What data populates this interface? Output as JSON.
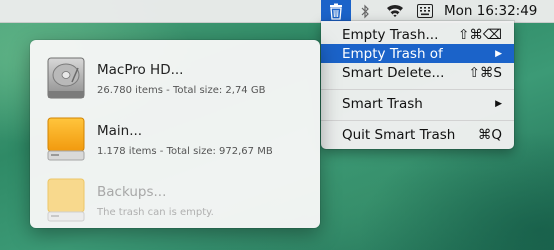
{
  "menubar": {
    "clock": "Mon 16:32:49",
    "icons": [
      "trash-icon",
      "bluetooth-icon",
      "wifi-icon",
      "keyboard-icon"
    ]
  },
  "menu": {
    "items": [
      {
        "label": "Empty Trash...",
        "shortcut": "⇧⌘⌫"
      },
      {
        "label": "Empty Trash of",
        "submenu": true,
        "selected": true
      },
      {
        "label": "Smart Delete...",
        "shortcut": "⇧⌘S"
      },
      {
        "label": "Smart Trash",
        "submenu": true
      },
      {
        "label": "Quit Smart Trash",
        "shortcut": "⌘Q"
      }
    ]
  },
  "disks": [
    {
      "name": "MacPro HD...",
      "info": "26.780 items - Total size: 2,74 GB",
      "icon": "internal-drive-icon"
    },
    {
      "name": "Main...",
      "info": "1.178 items - Total size: 972,67 MB",
      "icon": "external-drive-icon"
    },
    {
      "name": "Backups...",
      "info": "The trash can is empty.",
      "icon": "external-drive-icon",
      "disabled": true
    }
  ],
  "colors": {
    "highlight": "#1b63c9",
    "drive_orange": "#f5a623",
    "drive_disabled": "#f7d88a"
  }
}
